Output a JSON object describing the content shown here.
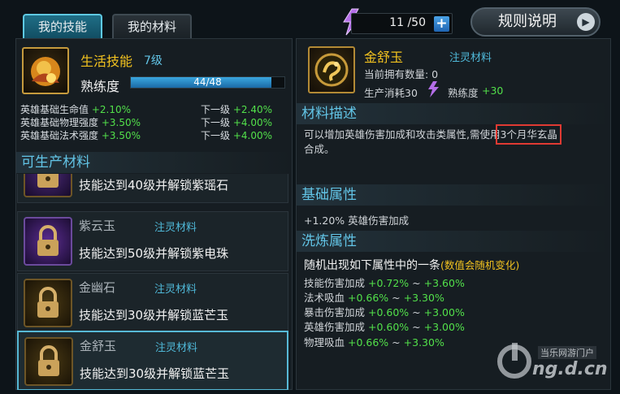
{
  "tabs": {
    "my_skills": "我的技能",
    "my_materials": "我的材料"
  },
  "energy": {
    "icon_label": "精",
    "value": "11 /50",
    "plus": "+"
  },
  "rules_button": "规则说明",
  "skill": {
    "name": "生活技能",
    "level": "7级",
    "proficiency_label": "熟练度",
    "proficiency_value": "44/48",
    "proficiency_fraction": 0.9167,
    "stats": [
      {
        "label": "英雄基础生命值",
        "value": "+2.10%",
        "next_label": "下一级",
        "next_value": "+2.40%"
      },
      {
        "label": "英雄基础物理强度",
        "value": "+3.50%",
        "next_label": "下一级",
        "next_value": "+4.00%"
      },
      {
        "label": "英雄基础法术强度",
        "value": "+3.50%",
        "next_label": "下一级",
        "next_value": "+4.00%"
      }
    ]
  },
  "producible": {
    "title": "可生产材料",
    "items": [
      {
        "name": "",
        "type": "",
        "unlock": "技能达到40级并解锁紫瑶石",
        "color": "purple"
      },
      {
        "name": "紫云玉",
        "type": "注灵材料",
        "unlock": "技能达到50级并解锁紫电珠",
        "color": "purple"
      },
      {
        "name": "金幽石",
        "type": "注灵材料",
        "unlock": "技能达到30级并解锁蓝芒玉",
        "color": "gold"
      },
      {
        "name": "金舒玉",
        "type": "注灵材料",
        "unlock": "技能达到30级并解锁蓝芒玉",
        "color": "gold"
      }
    ]
  },
  "material": {
    "name": "金舒玉",
    "type": "注灵材料",
    "owned": "当前拥有数量: 0",
    "cost_label": "生产消耗30",
    "proficiency_label": "熟练度",
    "proficiency_gain": "+30",
    "desc_title": "材料描述",
    "desc_before": "可以增加英雄伤害加成和攻击类属性,需使用",
    "desc_highlight": "3个月华玄晶",
    "desc_after": "合成。",
    "base_title": "基础属性",
    "base_value": "+1.20% 英雄伤害加成",
    "refine_title": "洗炼属性",
    "refine_intro": "随机出现如下属性中的一条",
    "refine_note": "(数值会随机变化)",
    "refine_rows": [
      {
        "label": "技能伤害加成",
        "min": "+0.72%",
        "tilde": "~",
        "max": "+3.60%"
      },
      {
        "label": "法术吸血",
        "min": "+0.66%",
        "tilde": "~",
        "max": "+3.30%"
      },
      {
        "label": "暴击伤害加成",
        "min": "+0.60%",
        "tilde": "~",
        "max": "+3.00%"
      },
      {
        "label": "英雄伤害加成",
        "min": "+0.60%",
        "tilde": "~",
        "max": "+3.00%"
      },
      {
        "label": "物理吸血",
        "min": "+0.66%",
        "tilde": "~",
        "max": "+3.30%"
      }
    ]
  },
  "watermark": {
    "top": "当乐网游门户",
    "bottom": "ng.d.cn"
  },
  "colors": {
    "accent": "#62c4e6",
    "green": "#52e04a",
    "highlight_box": "#e03a33"
  }
}
